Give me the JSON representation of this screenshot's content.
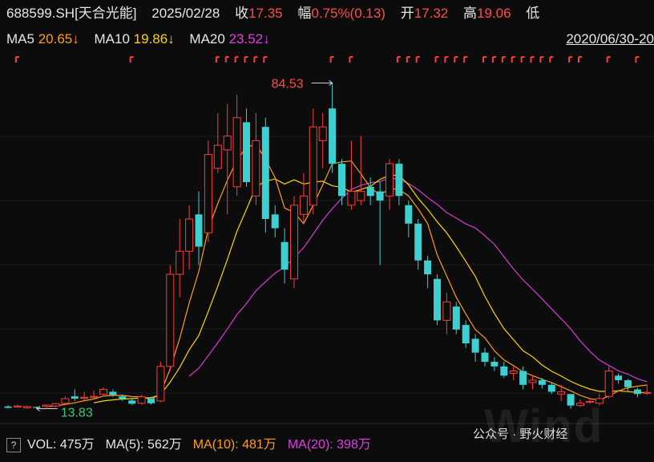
{
  "header": {
    "code": "688599.SH[天合光能]",
    "date": "2025/02/28",
    "close_label": "收",
    "close": "17.35",
    "chg_label": "幅",
    "chg": "0.75%(0.13)",
    "open_label": "开",
    "open": "17.32",
    "high_label": "高",
    "high": "19.06",
    "low_label": "低"
  },
  "ma_row": {
    "ma5_label": "MA5",
    "ma5": "20.65↓",
    "ma10_label": "MA10",
    "ma10": "19.86↓",
    "ma20_label": "MA20",
    "ma20": "23.52↓",
    "range": "2020/06/30-20"
  },
  "volume_row": {
    "help": "?",
    "vol": "VOL: 475万",
    "ma5": "MA(5): 562万",
    "ma10": "MA(10): 481万",
    "ma20": "MA(20): 398万"
  },
  "watermark": {
    "text": "公众号 · 野火财经",
    "logo": "Wind"
  },
  "colors": {
    "up": "#ff3b3b",
    "down": "#3ecfd0",
    "ma5": "#ff9c1a",
    "ma10": "#ffd400",
    "ma20": "#d63bd6",
    "bg": "#0c0c0c"
  },
  "chart_data": {
    "type": "candlestick",
    "annotations": {
      "max": "84.53",
      "min": "13.83"
    },
    "candles": [
      [
        14.3,
        14.0,
        14.6,
        13.9
      ],
      [
        14.3,
        14.4,
        14.7,
        14.1
      ],
      [
        14.0,
        14.3,
        14.5,
        13.9
      ],
      [
        14.2,
        14.0,
        14.3,
        13.83
      ],
      [
        14.3,
        14.6,
        14.8,
        14.0
      ],
      [
        14.4,
        14.9,
        15.1,
        14.1
      ],
      [
        15.0,
        16.0,
        16.5,
        14.8
      ],
      [
        16.5,
        16.0,
        18.0,
        15.5
      ],
      [
        16.2,
        16.3,
        17.5,
        15.6
      ],
      [
        16.4,
        16.5,
        17.8,
        16.0
      ],
      [
        17.0,
        18.0,
        18.4,
        16.5
      ],
      [
        17.5,
        16.8,
        18.0,
        16.4
      ],
      [
        16.5,
        16.0,
        16.9,
        15.5
      ],
      [
        15.6,
        14.9,
        16.2,
        14.6
      ],
      [
        15.0,
        16.4,
        16.8,
        14.7
      ],
      [
        16.0,
        15.0,
        16.4,
        14.7
      ],
      [
        15.5,
        23.0,
        24.0,
        15.2
      ],
      [
        23.0,
        43.0,
        45.0,
        22.0
      ],
      [
        43.0,
        48.0,
        55.0,
        38.0
      ],
      [
        48.0,
        55.0,
        58.0,
        44.0
      ],
      [
        56.0,
        49.0,
        61.0,
        45.0
      ],
      [
        52.0,
        69.0,
        72.0,
        50.0
      ],
      [
        66.0,
        71.0,
        78.0,
        65.0
      ],
      [
        70.0,
        73.0,
        80.0,
        56.0
      ],
      [
        62.0,
        77.0,
        82.0,
        60.0
      ],
      [
        76.0,
        63.0,
        79.0,
        62.0
      ],
      [
        60.0,
        72.0,
        78.0,
        58.0
      ],
      [
        75.0,
        55.0,
        77.0,
        52.0
      ],
      [
        56.0,
        53.0,
        58.0,
        51.0
      ],
      [
        50.0,
        44.0,
        53.0,
        41.0
      ],
      [
        42.0,
        58.0,
        60.0,
        40.0
      ],
      [
        56.0,
        60.0,
        65.0,
        54.0
      ],
      [
        58.0,
        75.0,
        79.0,
        56.0
      ],
      [
        72.0,
        75.0,
        78.0,
        66.0
      ],
      [
        79.0,
        67.0,
        84.53,
        65.0
      ],
      [
        67.0,
        60.0,
        68.0,
        58.0
      ],
      [
        58.0,
        61.0,
        72.0,
        57.0
      ],
      [
        59.0,
        61.0,
        73.0,
        58.0
      ],
      [
        62.0,
        60.0,
        64.0,
        58.0
      ],
      [
        61.0,
        59.0,
        63.0,
        45.0
      ],
      [
        60.0,
        67.0,
        68.0,
        57.0
      ],
      [
        67.0,
        60.0,
        68.0,
        58.0
      ],
      [
        58.0,
        54.0,
        59.0,
        51.0
      ],
      [
        54.0,
        46.0,
        55.0,
        44.0
      ],
      [
        46.0,
        43.0,
        47.0,
        40.0
      ],
      [
        42.0,
        33.0,
        43.0,
        32.0
      ],
      [
        33.0,
        37.0,
        39.0,
        30.0
      ],
      [
        36.0,
        31.0,
        37.0,
        30.0
      ],
      [
        32.0,
        28.0,
        33.0,
        27.0
      ],
      [
        29.0,
        26.0,
        30.0,
        24.0
      ],
      [
        26.0,
        24.0,
        27.0,
        23.0
      ],
      [
        24.0,
        23.0,
        25.0,
        22.0
      ],
      [
        23.0,
        21.0,
        24.0,
        20.5
      ],
      [
        21.5,
        22.0,
        23.0,
        20.0
      ],
      [
        22.0,
        19.0,
        23.0,
        18.0
      ],
      [
        19.5,
        20.0,
        21.0,
        18.0
      ],
      [
        20.0,
        19.0,
        20.5,
        18.2
      ],
      [
        19.0,
        17.5,
        19.5,
        17.0
      ],
      [
        17.0,
        17.5,
        19.0,
        15.5
      ],
      [
        17.0,
        14.5,
        17.0,
        13.8
      ],
      [
        14.5,
        15.0,
        15.8,
        14.2
      ],
      [
        15.3,
        15.4,
        16.3,
        14.9
      ],
      [
        15.0,
        16.0,
        17.0,
        14.5
      ],
      [
        16.5,
        22.0,
        23.0,
        16.0
      ],
      [
        21.0,
        20.0,
        21.5,
        19.2
      ],
      [
        20.0,
        18.5,
        20.3,
        17.5
      ],
      [
        18.0,
        17.0,
        18.4,
        16.3
      ],
      [
        17.3,
        17.35,
        19.06,
        16.8
      ]
    ]
  }
}
